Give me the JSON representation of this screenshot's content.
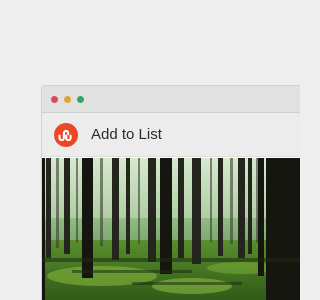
{
  "colors": {
    "close": "#e0465b",
    "minimize": "#e3a437",
    "maximize": "#2fa66a",
    "brand": "#eb4924"
  },
  "window": {
    "controls": [
      "close-icon",
      "minimize-icon",
      "maximize-icon"
    ]
  },
  "header": {
    "logo_icon": "stumbleupon-logo-icon",
    "title": "Add to List"
  },
  "content": {
    "image": "forest-photo"
  }
}
